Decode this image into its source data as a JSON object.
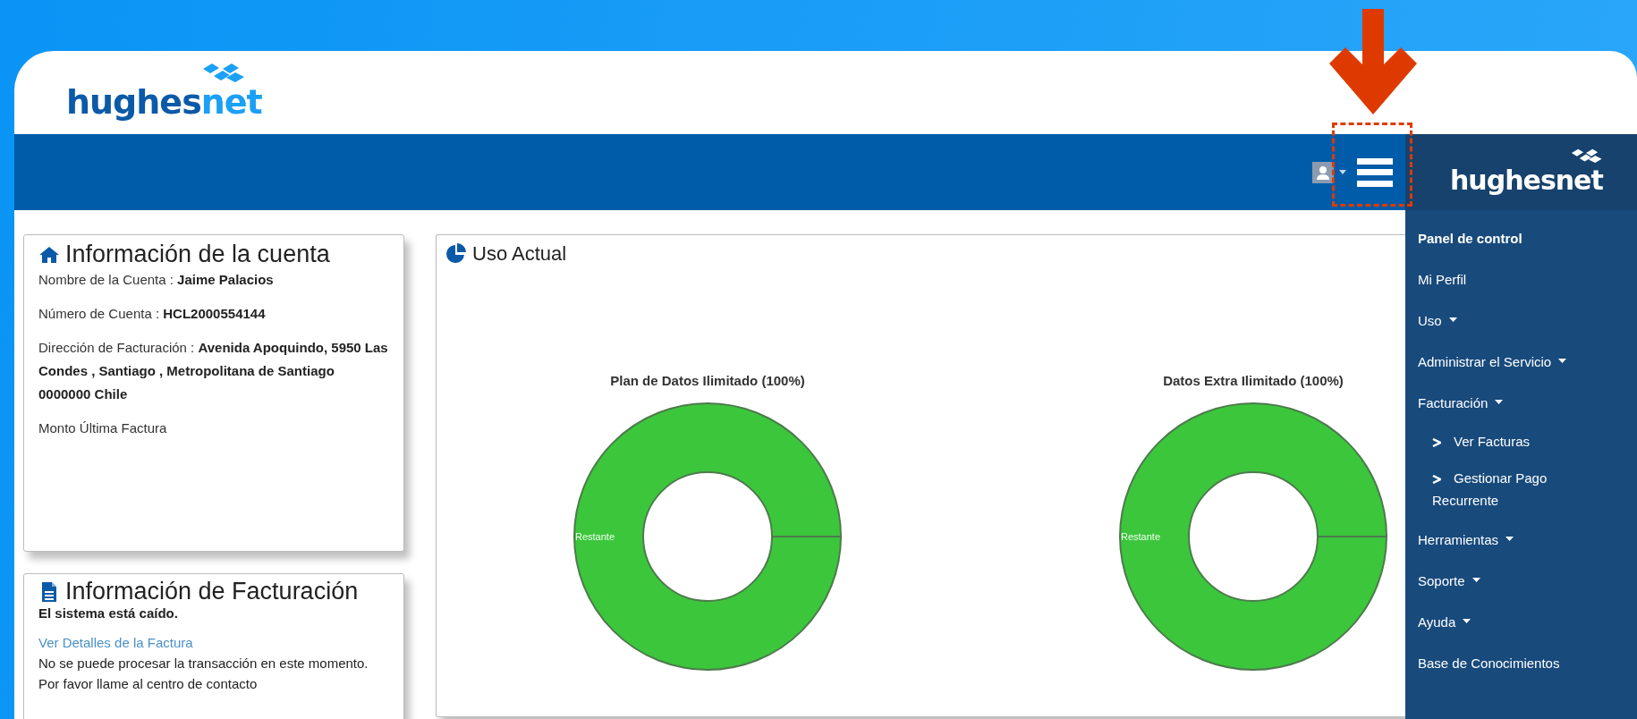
{
  "logo": {
    "lead": "hughes",
    "tail": "net"
  },
  "account_card": {
    "title": "Información de la cuenta",
    "fields": [
      {
        "label": "Nombre de la Cuenta : ",
        "value": "Jaime Palacios"
      },
      {
        "label": "Número de Cuenta : ",
        "value": "HCL2000554144"
      },
      {
        "label": "Dirección de Facturación : ",
        "value": "Avenida Apoquindo, 5950 Las Condes , Santiago , Metropolitana de Santiago 0000000 Chile"
      },
      {
        "label": "Monto Última Factura"
      }
    ]
  },
  "billing_card": {
    "title": "Información de Facturación",
    "status": "El sistema está caído.",
    "link": "Ver Detalles de la Factura",
    "message": "No se puede procesar la transacción en este momento. Por favor llame al centro de contacto"
  },
  "usage_card": {
    "title": "Uso Actual",
    "charts": [
      {
        "chart_data": {
          "type": "donut",
          "title": "Plan de Datos Ilimitado (100%)",
          "categories": [
            "Restante"
          ],
          "values": [
            100
          ]
        }
      },
      {
        "chart_data": {
          "type": "donut",
          "title": "Datos Extra Ilimitado (100%)",
          "categories": [
            "Restante"
          ],
          "values": [
            100
          ]
        }
      }
    ]
  },
  "sidebar": {
    "logo": "hughesnet",
    "items": [
      {
        "label": "Panel de control",
        "selected": true,
        "dropdown": false
      },
      {
        "label": "Mi Perfil",
        "selected": false,
        "dropdown": false
      },
      {
        "label": "Uso",
        "selected": false,
        "dropdown": true
      },
      {
        "label": "Administrar el Servicio",
        "selected": false,
        "dropdown": true
      },
      {
        "label": "Facturación",
        "selected": false,
        "dropdown": true,
        "children": [
          {
            "label": "Ver Facturas",
            "selected": false
          },
          {
            "label": "Gestionar Pago Recurrente",
            "selected": false
          }
        ]
      },
      {
        "label": "Herramientas",
        "selected": false,
        "dropdown": true
      },
      {
        "label": "Soporte",
        "selected": false,
        "dropdown": true
      },
      {
        "label": "Ayuda",
        "selected": false,
        "dropdown": true
      },
      {
        "label": "Base de Conocimientos",
        "selected": false,
        "dropdown": false
      }
    ]
  }
}
